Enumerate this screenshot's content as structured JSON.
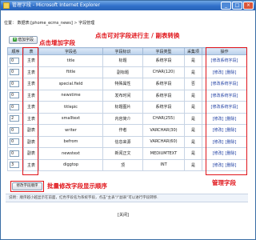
{
  "window": {
    "title": "管理字段 - Microsoft Internet Explorer"
  },
  "location": {
    "label": "位置：",
    "db": "数据表:[phome_ecms_news]",
    "sep": ">",
    "current": "字段管理"
  },
  "buttons": {
    "add_field": "增加字段",
    "batch_sort": "修改字段顺序"
  },
  "notes": {
    "add": "点击增加字段",
    "switch": "点击可对字段进行主 / 副表转换",
    "batch": "批量修改字段显示顺序",
    "manage": "管理字段"
  },
  "table": {
    "headers": [
      "顺序",
      "表",
      "字段名",
      "字段标识",
      "字段类型",
      "采集项",
      "操作"
    ],
    "rows": [
      {
        "sort": "0",
        "table": "主表",
        "name": "title",
        "label": "标题",
        "type": "系统字段",
        "collect": "是",
        "ops": [
          "修改系统字段"
        ],
        "name_red": false,
        "ops_red": true
      },
      {
        "sort": "0",
        "table": "主表",
        "name": "ftitle",
        "label": "副标题",
        "type": "CHAR(120)",
        "collect": "是",
        "ops": [
          "修改",
          "删除"
        ],
        "name_red": false,
        "ops_red": false
      },
      {
        "sort": "0",
        "table": "主表",
        "name": "special.field",
        "label": "特殊属性",
        "type": "系统字段",
        "collect": "否",
        "ops": [
          "修改系统字段"
        ],
        "name_red": true,
        "ops_red": true
      },
      {
        "sort": "0",
        "table": "主表",
        "name": "newstime",
        "label": "发布时间",
        "type": "系统字段",
        "collect": "是",
        "ops": [
          "修改系统字段"
        ],
        "name_red": true,
        "ops_red": true
      },
      {
        "sort": "0",
        "table": "主表",
        "name": "titlepic",
        "label": "标题图片",
        "type": "系统字段",
        "collect": "是",
        "ops": [
          "修改系统字段"
        ],
        "name_red": true,
        "ops_red": true
      },
      {
        "sort": "2",
        "table": "主表",
        "name": "smalltext",
        "label": "内容简介",
        "type": "CHAR(255)",
        "collect": "是",
        "ops": [
          "修改",
          "删除"
        ],
        "name_red": false,
        "ops_red": false
      },
      {
        "sort": "0",
        "table": "副表",
        "name": "writer",
        "label": "作者",
        "type": "VARCHAR(30)",
        "collect": "是",
        "ops": [
          "修改",
          "删除"
        ],
        "name_red": false,
        "ops_red": false
      },
      {
        "sort": "0",
        "table": "副表",
        "name": "befrom",
        "label": "信息来源",
        "type": "VARCHAR(60)",
        "collect": "是",
        "ops": [
          "修改",
          "删除"
        ],
        "name_red": false,
        "ops_red": false
      },
      {
        "sort": "0",
        "table": "副表",
        "name": "newstext",
        "label": "新闻正文",
        "type": "MEDIUMTEXT",
        "collect": "是",
        "ops": [
          "修改",
          "删除"
        ],
        "name_red": false,
        "ops_red": false
      },
      {
        "sort": "3",
        "table": "主表",
        "name": "diggtop",
        "label": "顶",
        "type": "INT",
        "collect": "是",
        "ops": [
          "修改",
          "删除"
        ],
        "name_red": false,
        "ops_red": false
      }
    ]
  },
  "description": "说明：顺序越小越显示在前面，红色字段名为系统字段，点击\"主表\"/\"副表\"可以进行字段转移.",
  "close_label": "[关闭]",
  "colors": {
    "titlebar": "#2f6fc9",
    "annotation": "#e0141a",
    "link": "#1f3fa3"
  }
}
